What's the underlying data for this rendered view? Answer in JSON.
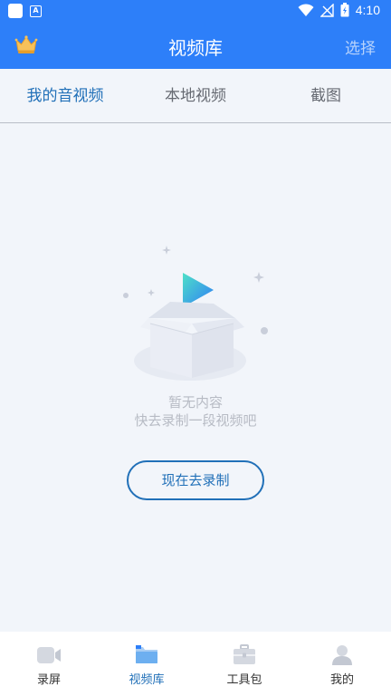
{
  "status_bar": {
    "time": "4:10",
    "badge_letter": "A"
  },
  "header": {
    "title": "视频库",
    "select_label": "选择"
  },
  "tabs": [
    {
      "label": "我的音视频",
      "active": true
    },
    {
      "label": "本地视频",
      "active": false
    },
    {
      "label": "截图",
      "active": false
    }
  ],
  "empty_state": {
    "title": "暂无内容",
    "subtitle": "快去录制一段视频吧",
    "button_label": "现在去录制"
  },
  "bottom_nav": [
    {
      "label": "录屏",
      "icon": "video-camera-icon",
      "active": false
    },
    {
      "label": "视频库",
      "icon": "folder-icon",
      "active": true
    },
    {
      "label": "工具包",
      "icon": "toolbox-icon",
      "active": false
    },
    {
      "label": "我的",
      "icon": "person-icon",
      "active": false
    }
  ],
  "colors": {
    "primary": "#2d7ff9",
    "accent_text": "#2170b8",
    "background": "#f2f5fa"
  }
}
